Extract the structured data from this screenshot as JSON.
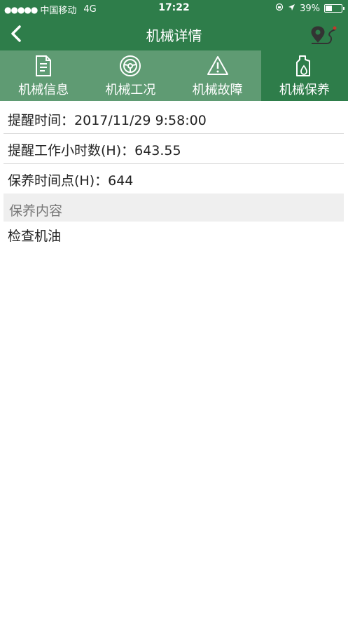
{
  "status_bar": {
    "carrier": "中国移动",
    "network": "4G",
    "time": "17:22",
    "battery_percent_label": "39%",
    "battery_level": 0.39
  },
  "nav": {
    "title": "机械详情"
  },
  "tabs": [
    {
      "label": "机械信息",
      "icon": "document-icon"
    },
    {
      "label": "机械工况",
      "icon": "steering-wheel-icon"
    },
    {
      "label": "机械故障",
      "icon": "warning-icon"
    },
    {
      "label": "机械保养",
      "icon": "oil-bottle-icon",
      "active": true
    }
  ],
  "details": {
    "reminder_time_label": "提醒时间：",
    "reminder_time_value": "2017/11/29 9:58:00",
    "reminder_hours_label": "提醒工作小时数(H)：",
    "reminder_hours_value": "643.55",
    "maintenance_point_label": "保养时间点(H)：",
    "maintenance_point_value": "644"
  },
  "maintenance": {
    "section_title": "保养内容",
    "items": [
      "检查机油"
    ]
  },
  "colors": {
    "header": "#2e7d4a",
    "tab_bar": "#5f9b73"
  }
}
